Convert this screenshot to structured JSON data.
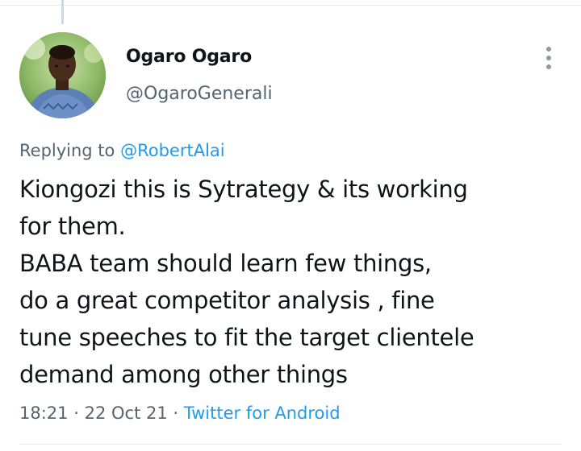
{
  "tweet": {
    "author": {
      "name": "Ogaro Ogaro",
      "handle": "@OgaroGenerali"
    },
    "replying_prefix": "Replying to",
    "replying_to": "@RobertAlai",
    "text_lines": [
      "Kiongozi this is Sytrategy & its working",
      "for them.",
      "BABA team should learn few things,",
      "do a great competitor analysis , fine",
      "tune speeches to fit the target clientele",
      "demand among other things"
    ],
    "time": "18:21",
    "date": "22 Oct 21",
    "separator": "·",
    "source": "Twitter for Android"
  },
  "icons": {
    "more": "more-vertical-icon"
  },
  "colors": {
    "text": "#0f1419",
    "secondary": "#536471",
    "link": "#1d9bf0",
    "border": "#e6ecf0",
    "thread_line": "#cfd9de"
  }
}
